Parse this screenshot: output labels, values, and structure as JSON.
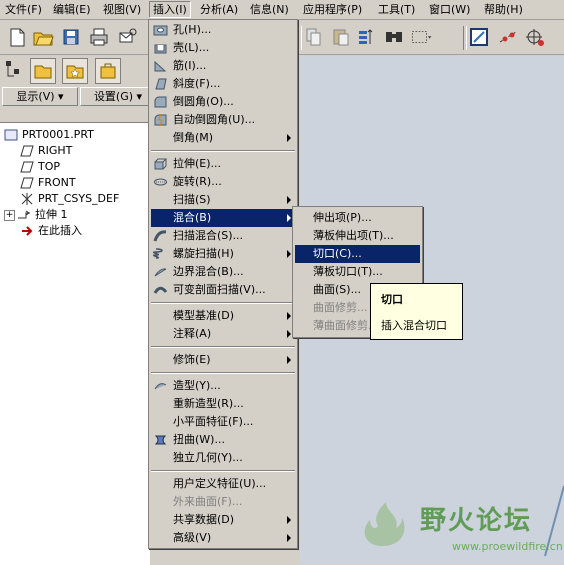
{
  "menubar": [
    {
      "label": "文件(F)"
    },
    {
      "label": "编辑(E)"
    },
    {
      "label": "视图(V)"
    },
    {
      "label": "插入(I)"
    },
    {
      "label": "分析(A)"
    },
    {
      "label": "信息(N)"
    },
    {
      "label": "应用程序(P)"
    },
    {
      "label": "工具(T)"
    },
    {
      "label": "窗口(W)"
    },
    {
      "label": "帮助(H)"
    }
  ],
  "panel": {
    "display_button": "显示(V) ▾",
    "settings_button": "设置(G) ▾",
    "tree": [
      {
        "label": "PRT0001.PRT"
      },
      {
        "label": "RIGHT"
      },
      {
        "label": "TOP"
      },
      {
        "label": "FRONT"
      },
      {
        "label": "PRT_CSYS_DEF"
      },
      {
        "label": "拉伸 1"
      },
      {
        "label": "在此插入"
      }
    ]
  },
  "insert_menu": {
    "items": [
      {
        "label": "孔(H)...",
        "icon": "hole-icon"
      },
      {
        "label": "壳(L)...",
        "icon": "shell-icon"
      },
      {
        "label": "筋(I)...",
        "icon": "rib-icon"
      },
      {
        "label": "斜度(F)...",
        "icon": "draft-icon"
      },
      {
        "label": "倒圆角(O)...",
        "icon": "round-icon"
      },
      {
        "label": "自动倒圆角(U)...",
        "icon": "auto-round-icon"
      },
      {
        "label": "倒角(M)",
        "icon": ""
      },
      {
        "label": "拉伸(E)...",
        "icon": "extrude-icon"
      },
      {
        "label": "旋转(R)...",
        "icon": "revolve-icon"
      },
      {
        "label": "扫描(S)",
        "icon": ""
      },
      {
        "label": "混合(B)",
        "icon": ""
      },
      {
        "label": "扫描混合(S)...",
        "icon": "swept-blend-icon"
      },
      {
        "label": "螺旋扫描(H)",
        "icon": "helical-sweep-icon"
      },
      {
        "label": "边界混合(B)...",
        "icon": "boundary-blend-icon"
      },
      {
        "label": "可变剖面扫描(V)...",
        "icon": "var-sect-sweep-icon"
      },
      {
        "label": "模型基准(D)",
        "icon": ""
      },
      {
        "label": "注释(A)",
        "icon": ""
      },
      {
        "label": "修饰(E)",
        "icon": ""
      },
      {
        "label": "造型(Y)...",
        "icon": "style-icon"
      },
      {
        "label": "重新造型(R)...",
        "icon": ""
      },
      {
        "label": "小平面特征(F)...",
        "icon": ""
      },
      {
        "label": "扭曲(W)...",
        "icon": "warp-icon"
      },
      {
        "label": "独立几何(Y)...",
        "icon": ""
      },
      {
        "label": "用户定义特征(U)...",
        "icon": ""
      },
      {
        "label": "外来曲面(F)...",
        "icon": ""
      },
      {
        "label": "共享数据(D)",
        "icon": ""
      },
      {
        "label": "高级(V)",
        "icon": ""
      }
    ]
  },
  "blend_menu": {
    "items": [
      {
        "label": "伸出项(P)..."
      },
      {
        "label": "薄板伸出项(T)..."
      },
      {
        "label": "切口(C)..."
      },
      {
        "label": "薄板切口(T)..."
      },
      {
        "label": "曲面(S)..."
      },
      {
        "label": "曲面修剪..."
      },
      {
        "label": "薄曲面修剪..."
      }
    ]
  },
  "tooltip": {
    "title": "切口",
    "text": "插入混合切口"
  },
  "watermark": {
    "title": "野火论坛",
    "url": "www.proewildfire.cn"
  },
  "colors": {
    "menu_bg": "#d4d0c8",
    "selection": "#0a246a",
    "tooltip_bg": "#ffffe1",
    "watermark": "#4aa02c"
  }
}
